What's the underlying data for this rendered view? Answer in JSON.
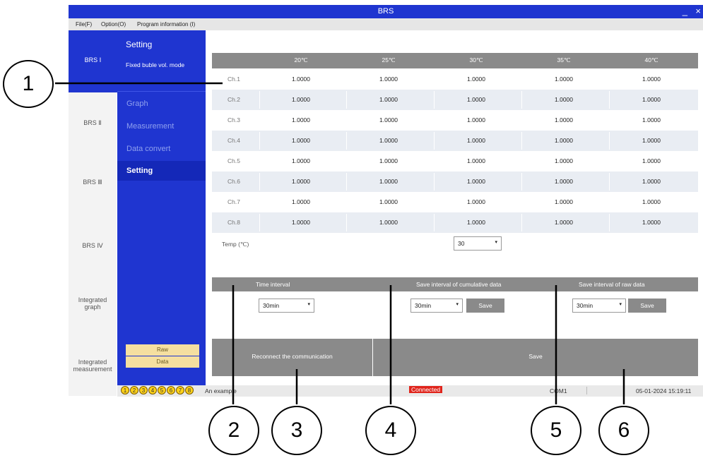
{
  "window": {
    "title": "BRS",
    "minimize": "_",
    "close": "×"
  },
  "menu": [
    "File(F)",
    "Option(O)",
    "Program information (I)"
  ],
  "devices": [
    "BRS Ⅰ",
    "BRS Ⅱ",
    "BRS Ⅲ",
    "BRS Ⅳ",
    "Integrated graph",
    "Integrated measurement"
  ],
  "nav": {
    "header": "Setting",
    "subheader": "Fixed buble vol. mode",
    "items": [
      "Graph",
      "Measurement",
      "Data convert",
      "Setting"
    ],
    "selected": "Setting",
    "raw_label": "Raw",
    "data_label": "Data"
  },
  "table": {
    "headers": [
      "20℃",
      "25℃",
      "30℃",
      "35℃",
      "40℃"
    ],
    "rows": [
      {
        "ch": "Ch.1",
        "values": [
          "1.0000",
          "1.0000",
          "1.0000",
          "1.0000",
          "1.0000"
        ]
      },
      {
        "ch": "Ch.2",
        "values": [
          "1.0000",
          "1.0000",
          "1.0000",
          "1.0000",
          "1.0000"
        ]
      },
      {
        "ch": "Ch.3",
        "values": [
          "1.0000",
          "1.0000",
          "1.0000",
          "1.0000",
          "1.0000"
        ]
      },
      {
        "ch": "Ch.4",
        "values": [
          "1.0000",
          "1.0000",
          "1.0000",
          "1.0000",
          "1.0000"
        ]
      },
      {
        "ch": "Ch.5",
        "values": [
          "1.0000",
          "1.0000",
          "1.0000",
          "1.0000",
          "1.0000"
        ]
      },
      {
        "ch": "Ch.6",
        "values": [
          "1.0000",
          "1.0000",
          "1.0000",
          "1.0000",
          "1.0000"
        ]
      },
      {
        "ch": "Ch.7",
        "values": [
          "1.0000",
          "1.0000",
          "1.0000",
          "1.0000",
          "1.0000"
        ]
      },
      {
        "ch": "Ch.8",
        "values": [
          "1.0000",
          "1.0000",
          "1.0000",
          "1.0000",
          "1.0000"
        ]
      }
    ]
  },
  "temp": {
    "label": "Temp (℃)",
    "value": "30"
  },
  "intervals": {
    "time_label": "Time interval",
    "time_value": "30min",
    "cumulative_label": "Save interval of cumulative data",
    "cumulative_value": "30min",
    "raw_label": "Save interval of raw data",
    "raw_value": "30min",
    "save_label": "Save"
  },
  "buttons": {
    "reconnect": "Reconnect the communication",
    "save": "Save"
  },
  "status": {
    "indicators": [
      "1",
      "2",
      "3",
      "4",
      "5",
      "6",
      "7",
      "8"
    ],
    "message": "An example",
    "connection": "Connected",
    "port": "COM1",
    "datetime": "05-01-2024 15:19:11"
  },
  "callouts": [
    "1",
    "2",
    "3",
    "4",
    "5",
    "6"
  ],
  "colors": {
    "nav_blue": "#1f35d0",
    "gray": "#8a8a8a",
    "connected_red": "#e0241b",
    "indicator_yellow": "#ffd21a"
  },
  "icons": {
    "dropdown": "chevron-down-icon"
  }
}
